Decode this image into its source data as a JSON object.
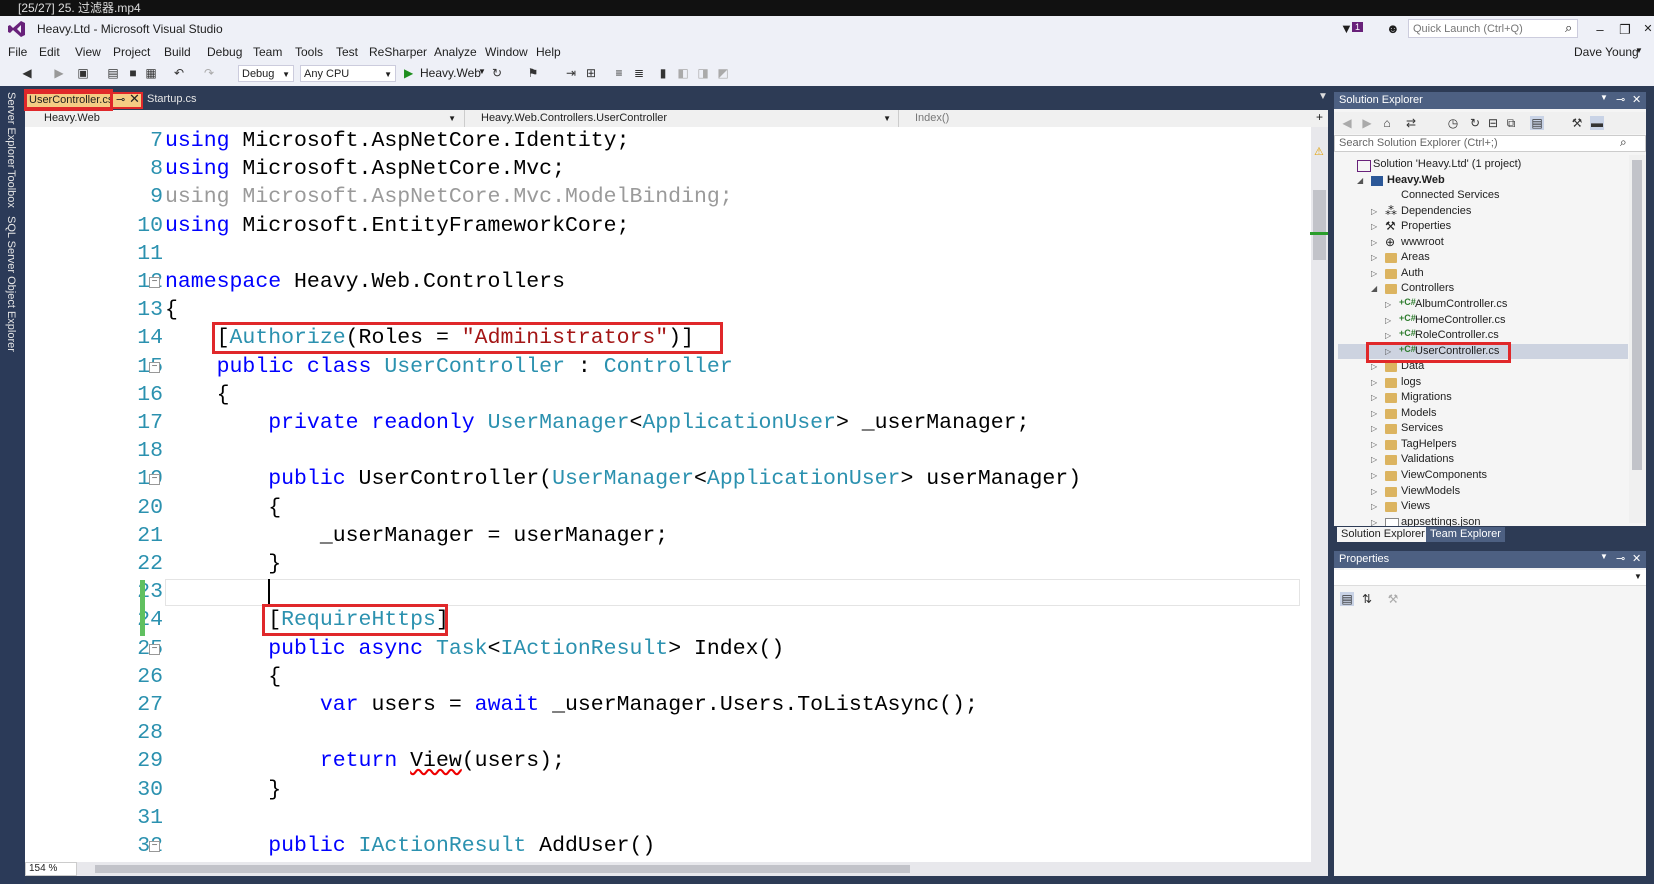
{
  "player": {
    "caption": "[25/27] 25. 过滤器.mp4"
  },
  "window": {
    "title": "Heavy.Ltd - Microsoft Visual Studio",
    "notification_count": "1",
    "quick_launch_placeholder": "Quick Launch (Ctrl+Q)",
    "user": "Dave Young"
  },
  "menu": [
    "File",
    "Edit",
    "View",
    "Project",
    "Build",
    "Debug",
    "Team",
    "Tools",
    "Test",
    "ReSharper",
    "Analyze",
    "Window",
    "Help"
  ],
  "toolbar": {
    "configuration": "Debug",
    "platform": "Any CPU",
    "start_target": "Heavy.Web"
  },
  "left_tabs": [
    "Server Explorer",
    "Toolbox",
    "SQL Server Object Explorer"
  ],
  "doc_tabs": [
    {
      "label": "UserController.cs",
      "active": true
    },
    {
      "label": "Startup.cs",
      "active": false
    }
  ],
  "navbar": {
    "project": "Heavy.Web",
    "class": "Heavy.Web.Controllers.UserController",
    "member": "Index()"
  },
  "editor": {
    "zoom": "154 %",
    "lines": [
      {
        "n": "7",
        "parts": [
          [
            "kw",
            "using"
          ],
          [
            "tx",
            " Microsoft.AspNetCore.Identity;"
          ]
        ]
      },
      {
        "n": "8",
        "parts": [
          [
            "kw",
            "using"
          ],
          [
            "tx",
            " Microsoft.AspNetCore.Mvc;"
          ]
        ]
      },
      {
        "n": "9",
        "parts": [
          [
            "gr",
            "using Microsoft.AspNetCore.Mvc.ModelBinding;"
          ]
        ]
      },
      {
        "n": "10",
        "parts": [
          [
            "kw",
            "using"
          ],
          [
            "tx",
            " Microsoft.EntityFrameworkCore;"
          ]
        ]
      },
      {
        "n": "11",
        "parts": []
      },
      {
        "n": "12",
        "parts": [
          [
            "kw",
            "namespace"
          ],
          [
            "tx",
            " Heavy.Web.Controllers"
          ]
        ]
      },
      {
        "n": "13",
        "parts": [
          [
            "tx",
            "{"
          ]
        ]
      },
      {
        "n": "14",
        "parts": [
          [
            "tx",
            "    ["
          ],
          [
            "ty",
            "Authorize"
          ],
          [
            "tx",
            "(Roles = "
          ],
          [
            "st",
            "\"Administrators\""
          ],
          [
            "tx",
            ")]"
          ]
        ]
      },
      {
        "n": "15",
        "parts": [
          [
            "tx",
            "    "
          ],
          [
            "kw",
            "public class"
          ],
          [
            "tx",
            " "
          ],
          [
            "ty",
            "UserController"
          ],
          [
            "tx",
            " : "
          ],
          [
            "ty",
            "Controller"
          ]
        ]
      },
      {
        "n": "16",
        "parts": [
          [
            "tx",
            "    {"
          ]
        ]
      },
      {
        "n": "17",
        "parts": [
          [
            "tx",
            "        "
          ],
          [
            "kw",
            "private readonly"
          ],
          [
            "tx",
            " "
          ],
          [
            "ty",
            "UserManager"
          ],
          [
            "tx",
            "<"
          ],
          [
            "ty",
            "ApplicationUser"
          ],
          [
            "tx",
            "> _userManager;"
          ]
        ]
      },
      {
        "n": "18",
        "parts": []
      },
      {
        "n": "19",
        "parts": [
          [
            "tx",
            "        "
          ],
          [
            "kw",
            "public"
          ],
          [
            "tx",
            " UserController("
          ],
          [
            "ty",
            "UserManager"
          ],
          [
            "tx",
            "<"
          ],
          [
            "ty",
            "ApplicationUser"
          ],
          [
            "tx",
            "> userManager)"
          ]
        ]
      },
      {
        "n": "20",
        "parts": [
          [
            "tx",
            "        {"
          ]
        ]
      },
      {
        "n": "21",
        "parts": [
          [
            "tx",
            "            _userManager = userManager;"
          ]
        ]
      },
      {
        "n": "22",
        "parts": [
          [
            "tx",
            "        }"
          ]
        ]
      },
      {
        "n": "23",
        "parts": [
          [
            "tx",
            "        "
          ]
        ]
      },
      {
        "n": "24",
        "parts": [
          [
            "tx",
            "        ["
          ],
          [
            "ty",
            "RequireHttps"
          ],
          [
            "tx",
            "]"
          ]
        ]
      },
      {
        "n": "25",
        "parts": [
          [
            "tx",
            "        "
          ],
          [
            "kw",
            "public async"
          ],
          [
            "tx",
            " "
          ],
          [
            "ty",
            "Task"
          ],
          [
            "tx",
            "<"
          ],
          [
            "ty",
            "IActionResult"
          ],
          [
            "tx",
            "> Index()"
          ]
        ]
      },
      {
        "n": "26",
        "parts": [
          [
            "tx",
            "        {"
          ]
        ]
      },
      {
        "n": "27",
        "parts": [
          [
            "tx",
            "            "
          ],
          [
            "kw",
            "var"
          ],
          [
            "tx",
            " users = "
          ],
          [
            "kw",
            "await"
          ],
          [
            "tx",
            " _userManager.Users.ToListAsync();"
          ]
        ]
      },
      {
        "n": "28",
        "parts": []
      },
      {
        "n": "29",
        "parts": [
          [
            "tx",
            "            "
          ],
          [
            "kw",
            "return"
          ],
          [
            "tx",
            " "
          ],
          [
            "sq",
            "View"
          ],
          [
            "tx",
            "(users);"
          ]
        ]
      },
      {
        "n": "30",
        "parts": [
          [
            "tx",
            "        }"
          ]
        ]
      },
      {
        "n": "31",
        "parts": []
      },
      {
        "n": "32",
        "parts": [
          [
            "tx",
            "        "
          ],
          [
            "kw",
            "public"
          ],
          [
            "tx",
            " "
          ],
          [
            "ty",
            "IActionResult"
          ],
          [
            "tx",
            " AddUser()"
          ]
        ]
      }
    ]
  },
  "solution_explorer": {
    "title": "Solution Explorer",
    "search_placeholder": "Search Solution Explorer (Ctrl+;)",
    "items": [
      {
        "label": "Solution 'Heavy.Ltd' (1 project)",
        "depth": 0,
        "icon": "solution",
        "arrow": ""
      },
      {
        "label": "Heavy.Web",
        "depth": 1,
        "icon": "project",
        "arrow": "open",
        "bold": true
      },
      {
        "label": "Connected Services",
        "depth": 2,
        "icon": "services",
        "arrow": ""
      },
      {
        "label": "Dependencies",
        "depth": 2,
        "icon": "deps",
        "arrow": "closed"
      },
      {
        "label": "Properties",
        "depth": 2,
        "icon": "wrench",
        "arrow": "closed"
      },
      {
        "label": "wwwroot",
        "depth": 2,
        "icon": "globe",
        "arrow": "closed"
      },
      {
        "label": "Areas",
        "depth": 2,
        "icon": "folder",
        "arrow": "closed"
      },
      {
        "label": "Auth",
        "depth": 2,
        "icon": "folder",
        "arrow": "closed"
      },
      {
        "label": "Controllers",
        "depth": 2,
        "icon": "folder",
        "arrow": "open"
      },
      {
        "label": "AlbumController.cs",
        "depth": 3,
        "icon": "cs",
        "arrow": "closed"
      },
      {
        "label": "HomeController.cs",
        "depth": 3,
        "icon": "cs",
        "arrow": "closed"
      },
      {
        "label": "RoleController.cs",
        "depth": 3,
        "icon": "cs",
        "arrow": "closed"
      },
      {
        "label": "UserController.cs",
        "depth": 3,
        "icon": "cs",
        "arrow": "closed",
        "selected": true
      },
      {
        "label": "Data",
        "depth": 2,
        "icon": "folder",
        "arrow": "closed"
      },
      {
        "label": "logs",
        "depth": 2,
        "icon": "folder",
        "arrow": "closed"
      },
      {
        "label": "Migrations",
        "depth": 2,
        "icon": "folder",
        "arrow": "closed"
      },
      {
        "label": "Models",
        "depth": 2,
        "icon": "folder",
        "arrow": "closed"
      },
      {
        "label": "Services",
        "depth": 2,
        "icon": "folder",
        "arrow": "closed"
      },
      {
        "label": "TagHelpers",
        "depth": 2,
        "icon": "folder",
        "arrow": "closed"
      },
      {
        "label": "Validations",
        "depth": 2,
        "icon": "folder",
        "arrow": "closed"
      },
      {
        "label": "ViewComponents",
        "depth": 2,
        "icon": "folder",
        "arrow": "closed"
      },
      {
        "label": "ViewModels",
        "depth": 2,
        "icon": "folder",
        "arrow": "closed"
      },
      {
        "label": "Views",
        "depth": 2,
        "icon": "folder",
        "arrow": "closed"
      },
      {
        "label": "appsettings.json",
        "depth": 2,
        "icon": "file",
        "arrow": "closed"
      }
    ],
    "bottom_tabs": [
      "Solution Explorer",
      "Team Explorer"
    ]
  },
  "properties": {
    "title": "Properties"
  },
  "colors": {
    "accent": "#4d6082",
    "highlight": "#e0282a",
    "keyword": "#0000ff",
    "type": "#2b91af",
    "string": "#a31515"
  }
}
